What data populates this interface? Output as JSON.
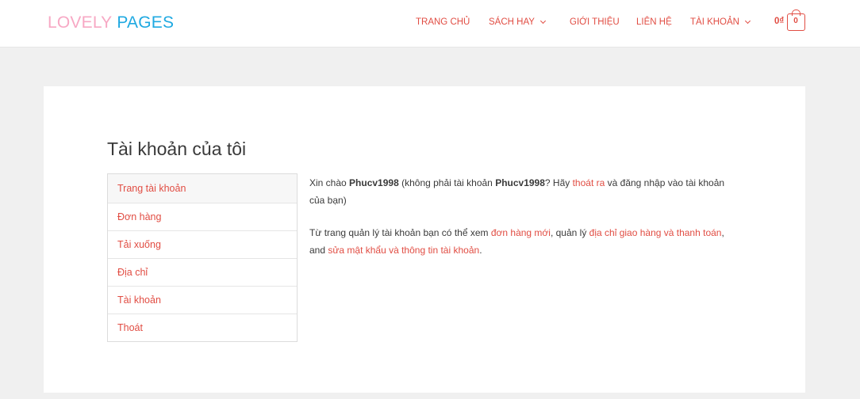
{
  "header": {
    "logo_part1": "LOVELY",
    "logo_part2": "PAGES",
    "nav": [
      {
        "label": "TRANG CHỦ"
      },
      {
        "label": "SÁCH HAY"
      },
      {
        "label": "GIỚI THIỆU"
      },
      {
        "label": "LIÊN HỆ"
      },
      {
        "label": "TÀI KHOẢN"
      }
    ],
    "cart_total": "0₫",
    "cart_count": "0"
  },
  "colors": {
    "accent": "#e14d43",
    "logo_pink": "#f7a8c4",
    "logo_blue": "#1fa9e1",
    "background": "#f0f0f0"
  },
  "page": {
    "title": "Tài khoản của tôi"
  },
  "account_nav": [
    {
      "label": "Trang tài khoản"
    },
    {
      "label": "Đơn hàng"
    },
    {
      "label": "Tải xuống"
    },
    {
      "label": "Địa chỉ"
    },
    {
      "label": "Tài khoản"
    },
    {
      "label": "Thoát"
    }
  ],
  "content": {
    "greeting_prefix": "Xin chào ",
    "username": "Phucv1998",
    "greeting_middle": " (không phải tài khoản ",
    "username_again": "Phucv1998",
    "greeting_question": "? Hãy ",
    "logout_link": "thoát ra",
    "greeting_suffix": " và đăng nhập vào tài khoản của bạn)",
    "dashboard_prefix": "Từ trang quản lý tài khoản bạn có thể xem ",
    "orders_link": "đơn hàng mới",
    "dashboard_middle": ", quản lý ",
    "addresses_link": "địa chỉ giao hàng và thanh toán",
    "dashboard_and": ", and ",
    "account_link": "sửa mật khẩu và thông tin tài khoản",
    "dashboard_end": "."
  }
}
